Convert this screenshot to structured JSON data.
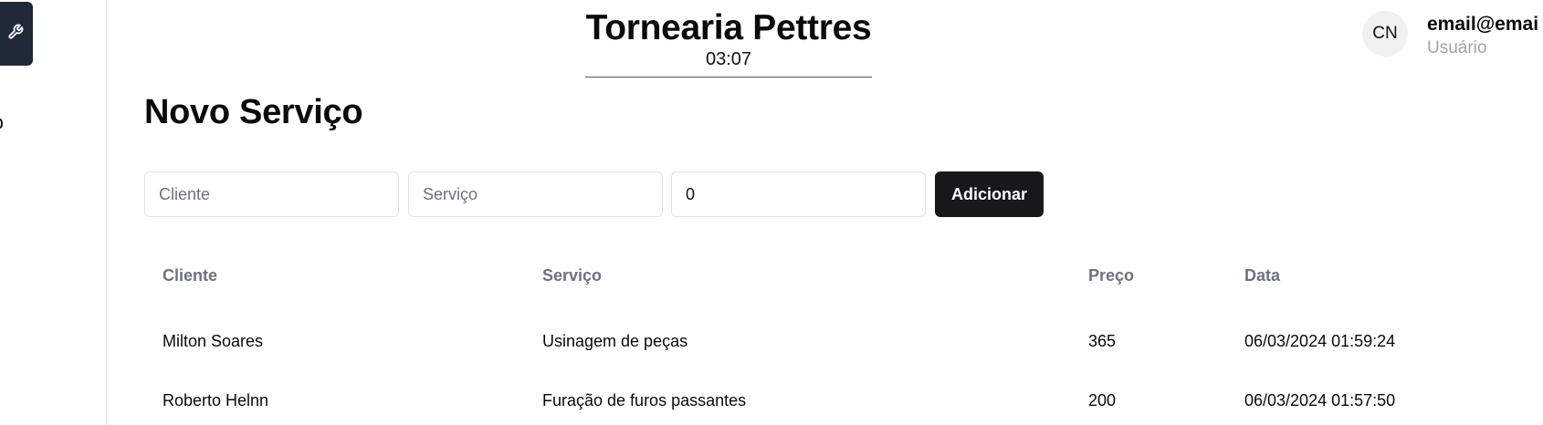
{
  "header": {
    "brand_title": "Tornearia Pettres",
    "time": "03:07"
  },
  "user": {
    "initials": "CN",
    "email": "email@emai",
    "role": "Usuário"
  },
  "page": {
    "title": "Novo Serviço"
  },
  "form": {
    "cliente": {
      "placeholder": "Cliente",
      "value": ""
    },
    "servico": {
      "placeholder": "Serviço",
      "value": ""
    },
    "preco": {
      "placeholder": "",
      "value": "0"
    },
    "submit_label": "Adicionar"
  },
  "table": {
    "columns": [
      "Cliente",
      "Serviço",
      "Preço",
      "Data"
    ],
    "rows": [
      [
        "Milton Soares",
        "Usinagem de peças",
        "365",
        "06/03/2024 01:59:24"
      ],
      [
        "Roberto Helnn",
        "Furação de furos passantes",
        "200",
        "06/03/2024 01:57:50"
      ]
    ]
  },
  "colors": {
    "sidebar_button": "#1f2937",
    "primary_button": "#18181b",
    "muted_text": "#6b7280"
  }
}
